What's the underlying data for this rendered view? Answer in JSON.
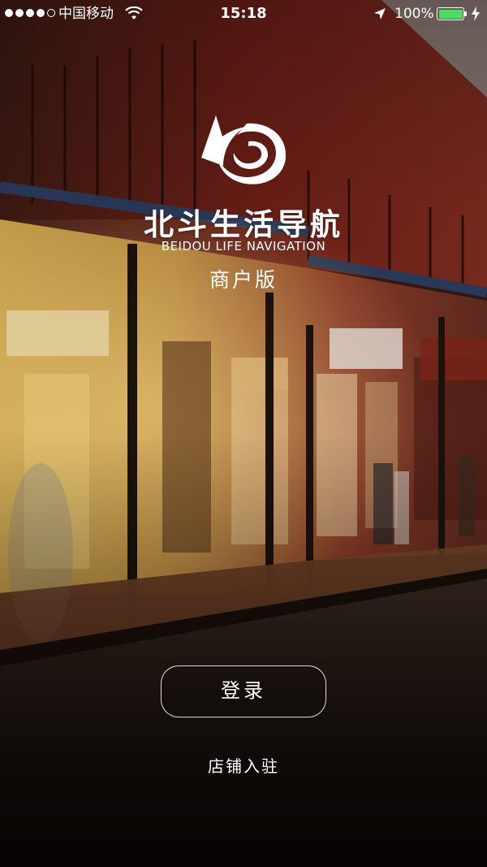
{
  "status_bar": {
    "signal_icon": "signal-dots-icon",
    "carrier": "中国移动",
    "wifi_icon": "wifi-icon",
    "time": "15:18",
    "location_icon": "location-arrow-icon",
    "battery_percent": "100%",
    "battery_level": 1.0,
    "battery_icon": "battery-icon",
    "charging_icon": "charging-bolt-icon",
    "battery_color": "#4cd964"
  },
  "brand": {
    "logo_icon": "compass-swirl-logo",
    "app_name": "北斗生活导航",
    "app_name_en": "BEIDOU LIFE NAVIGATION",
    "edition": "商户版"
  },
  "actions": {
    "login_label": "登录",
    "register_label": "店铺入驻"
  }
}
